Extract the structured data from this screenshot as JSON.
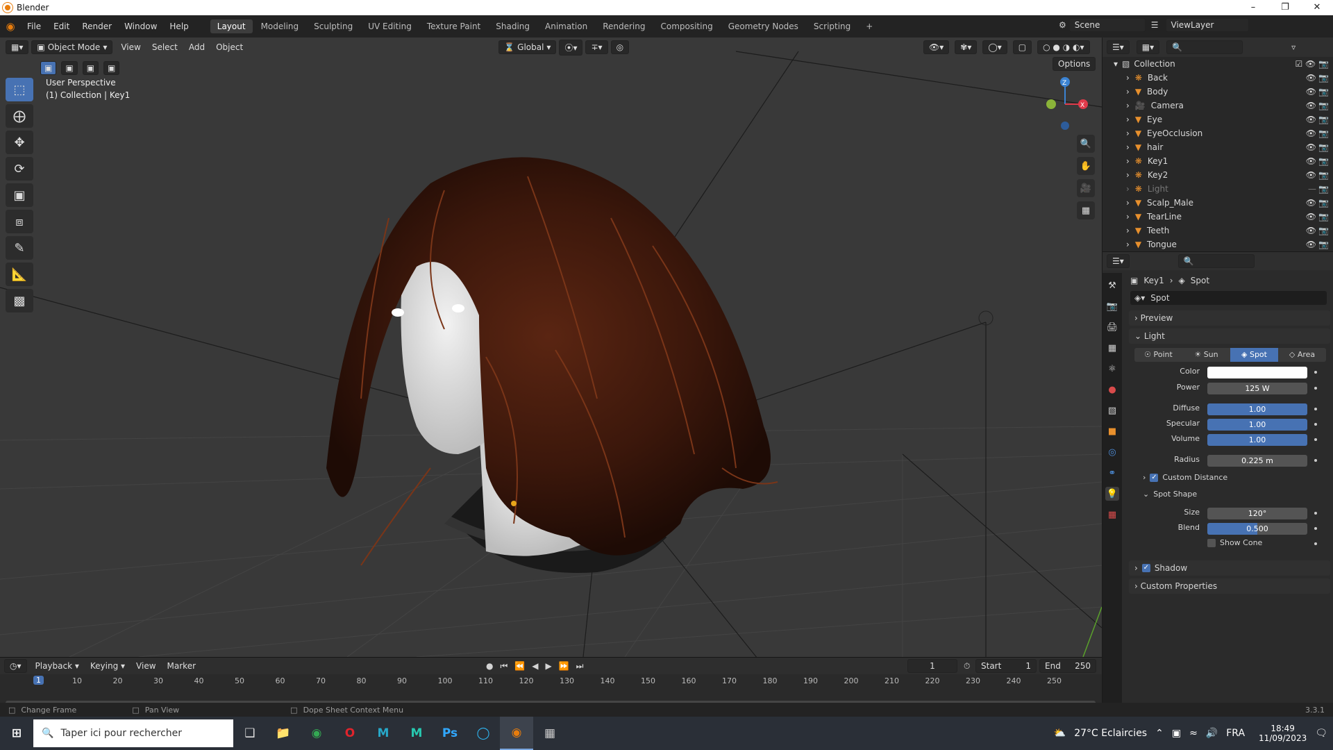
{
  "window": {
    "title": "Blender"
  },
  "menus": [
    "File",
    "Edit",
    "Render",
    "Window",
    "Help"
  ],
  "workspaces": [
    "Layout",
    "Modeling",
    "Sculpting",
    "UV Editing",
    "Texture Paint",
    "Shading",
    "Animation",
    "Rendering",
    "Compositing",
    "Geometry Nodes",
    "Scripting"
  ],
  "active_workspace": "Layout",
  "scene": {
    "name": "Scene",
    "view_layer": "ViewLayer"
  },
  "viewport": {
    "mode": "Object Mode",
    "menus": [
      "View",
      "Select",
      "Add",
      "Object"
    ],
    "orientation": "Global",
    "options": "Options",
    "perspective": "User Perspective",
    "context": "(1) Collection | Key1"
  },
  "outliner": {
    "collection": "Collection",
    "items": [
      {
        "name": "Back",
        "type": "light"
      },
      {
        "name": "Body",
        "type": "mesh"
      },
      {
        "name": "Camera",
        "type": "camera"
      },
      {
        "name": "Eye",
        "type": "mesh"
      },
      {
        "name": "EyeOcclusion",
        "type": "mesh"
      },
      {
        "name": "hair",
        "type": "mesh"
      },
      {
        "name": "Key1",
        "type": "light"
      },
      {
        "name": "Key2",
        "type": "light"
      },
      {
        "name": "Light",
        "type": "light",
        "hidden": true
      },
      {
        "name": "Scalp_Male",
        "type": "mesh"
      },
      {
        "name": "TearLine",
        "type": "mesh"
      },
      {
        "name": "Teeth",
        "type": "mesh"
      },
      {
        "name": "Tongue",
        "type": "mesh"
      }
    ]
  },
  "properties": {
    "breadcrumb_object": "Key1",
    "breadcrumb_data": "Spot",
    "datablock": "Spot",
    "sections": {
      "preview": "Preview",
      "light": "Light",
      "custom_distance": "Custom Distance",
      "spot_shape": "Spot Shape",
      "shadow": "Shadow",
      "custom_properties": "Custom Properties"
    },
    "light_types": [
      "Point",
      "Sun",
      "Spot",
      "Area"
    ],
    "active_light_type": "Spot",
    "labels": {
      "color": "Color",
      "power": "Power",
      "diffuse": "Diffuse",
      "specular": "Specular",
      "volume": "Volume",
      "radius": "Radius",
      "size": "Size",
      "blend": "Blend",
      "show_cone": "Show Cone"
    },
    "values": {
      "color": "#ffffff",
      "power": "125 W",
      "diffuse": "1.00",
      "specular": "1.00",
      "volume": "1.00",
      "radius": "0.225 m",
      "size": "120°",
      "blend": "0.500",
      "blend_fraction": 0.5
    },
    "custom_distance_checked": true,
    "shadow_checked": true,
    "show_cone_checked": false
  },
  "timeline": {
    "menus": [
      "Playback",
      "Keying",
      "View",
      "Marker"
    ],
    "current_frame": "1",
    "start_label": "Start",
    "start": "1",
    "end_label": "End",
    "end": "250",
    "ticks": [
      "10",
      "20",
      "30",
      "40",
      "50",
      "60",
      "70",
      "80",
      "90",
      "100",
      "110",
      "120",
      "130",
      "140",
      "150",
      "160",
      "170",
      "180",
      "190",
      "200",
      "210",
      "220",
      "230",
      "240",
      "250"
    ],
    "playhead": "1"
  },
  "status": {
    "left": "Change Frame",
    "middle": "Pan View",
    "right": "Dope Sheet Context Menu",
    "version": "3.3.1"
  },
  "taskbar": {
    "search_placeholder": "Taper ici pour rechercher",
    "weather": "27°C  Eclaircies",
    "lang": "FRA",
    "time": "18:49",
    "date": "11/09/2023"
  }
}
